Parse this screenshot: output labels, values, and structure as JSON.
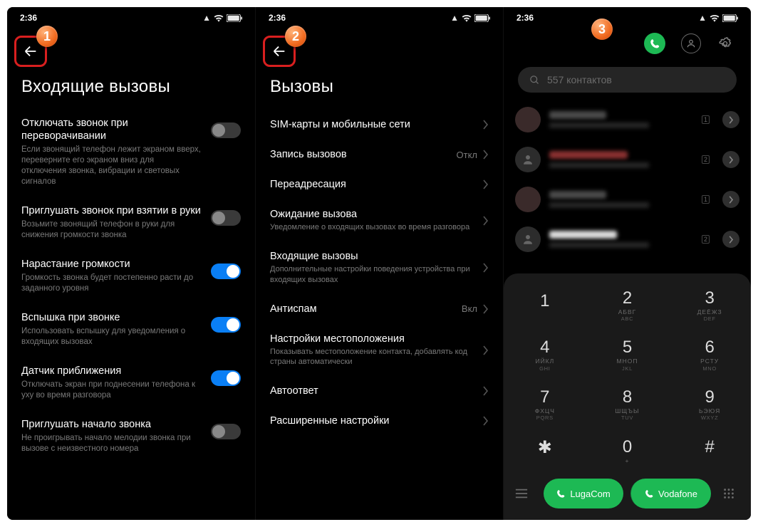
{
  "statusbar": {
    "time": "2:36"
  },
  "screen1": {
    "badge": "1",
    "title": "Входящие вызовы",
    "rows": [
      {
        "label": "Отключать звонок при переворачивании",
        "desc": "Если звонящий телефон лежит экраном вверх, переверните его экраном вниз для отключения звонка, вибрации и световых сигналов",
        "on": false
      },
      {
        "label": "Приглушать звонок при взятии в руки",
        "desc": "Возьмите звонящий телефон в руки для снижения громкости звонка",
        "on": false
      },
      {
        "label": "Нарастание громкости",
        "desc": "Громкость звонка будет постепенно расти до заданного уровня",
        "on": true
      },
      {
        "label": "Вспышка при звонке",
        "desc": "Использовать вспышку для уведомления о входящих вызовах",
        "on": true
      },
      {
        "label": "Датчик приближения",
        "desc": "Отключать экран при поднесении телефона к уху во время разговора",
        "on": true
      },
      {
        "label": "Приглушать начало звонка",
        "desc": "Не проигрывать начало мелодии звонка при вызове с неизвестного номера",
        "on": false
      }
    ]
  },
  "screen2": {
    "badge": "2",
    "title": "Вызовы",
    "rows": [
      {
        "label": "SIM-карты и мобильные сети",
        "desc": "",
        "val": ""
      },
      {
        "label": "Запись вызовов",
        "desc": "",
        "val": "Откл"
      },
      {
        "label": "Переадресация",
        "desc": "",
        "val": ""
      },
      {
        "label": "Ожидание вызова",
        "desc": "Уведомление о входящих вызовах во время разговора",
        "val": ""
      },
      {
        "label": "Входящие вызовы",
        "desc": "Дополнительные настройки поведения устройства при входящих вызовах",
        "val": ""
      },
      {
        "label": "Антиспам",
        "desc": "",
        "val": "Вкл"
      },
      {
        "label": "Настройки местоположения",
        "desc": "Показывать местоположение контакта, добавлять код страны автоматически",
        "val": ""
      },
      {
        "label": "Автоответ",
        "desc": "",
        "val": ""
      },
      {
        "label": "Расширенные настройки",
        "desc": "",
        "val": ""
      }
    ]
  },
  "screen3": {
    "badge": "3",
    "search": "557 контактов",
    "contacts_count": 4,
    "dialpad": [
      {
        "num": "1",
        "sub": "",
        "sub2": ""
      },
      {
        "num": "2",
        "sub": "АБВГ",
        "sub2": "ABC"
      },
      {
        "num": "3",
        "sub": "ДЕЁЖЗ",
        "sub2": "DEF"
      },
      {
        "num": "4",
        "sub": "ИЙКЛ",
        "sub2": "GHI"
      },
      {
        "num": "5",
        "sub": "МНОП",
        "sub2": "JKL"
      },
      {
        "num": "6",
        "sub": "РСТУ",
        "sub2": "MNO"
      },
      {
        "num": "7",
        "sub": "ФХЦЧ",
        "sub2": "PQRS"
      },
      {
        "num": "8",
        "sub": "ШЩЪЫ",
        "sub2": "TUV"
      },
      {
        "num": "9",
        "sub": "ЬЭЮЯ",
        "sub2": "WXYZ"
      },
      {
        "num": "✱",
        "sub": "",
        "sub2": ""
      },
      {
        "num": "0",
        "sub": "+",
        "sub2": ""
      },
      {
        "num": "#",
        "sub": "",
        "sub2": ""
      }
    ],
    "sim1": "LugaCom",
    "sim2": "Vodafone"
  }
}
